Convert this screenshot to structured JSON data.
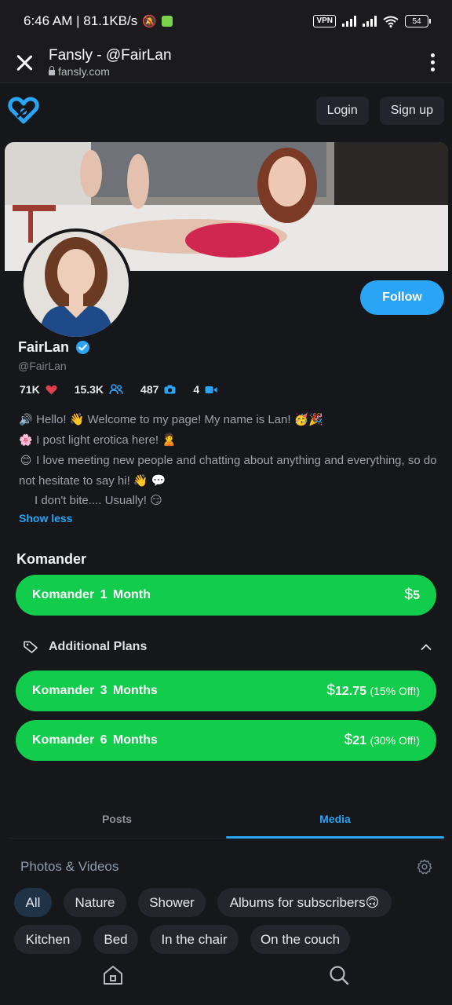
{
  "status_bar": {
    "time_speed": "6:46 AM | 81.1KB/s",
    "vpn": "VPN",
    "battery": "54"
  },
  "browser": {
    "title": "Fansly - @FairLan",
    "url": "fansly.com"
  },
  "header": {
    "login_label": "Login",
    "signup_label": "Sign up"
  },
  "profile": {
    "display_name": "FairLan",
    "handle": "@FairLan",
    "follow_label": "Follow",
    "stats": {
      "likes": "71K",
      "followers": "15.3K",
      "photos": "487",
      "videos": "4"
    },
    "bio": [
      {
        "emoji": "🔊",
        "text": "Hello! 👋 Welcome to my page! My name is Lan! 🥳🎉"
      },
      {
        "emoji": "🌸",
        "text": "I post light erotica here! 🙎"
      },
      {
        "emoji": "😊",
        "text": "I love meeting new people and chatting about anything and everything, so do not hesitate to say hi! 👋 💬"
      },
      {
        "emoji": "",
        "text": "I don't bite.... Usually! 😏"
      }
    ],
    "show_less_label": "Show less"
  },
  "subscriptions": {
    "tier_name": "Komander",
    "main_plan": {
      "name": "Komander 1 Month",
      "currency": "$",
      "price": "5",
      "discount": ""
    },
    "additional_label": "Additional Plans",
    "additional_plans": [
      {
        "name": "Komander 3 Months",
        "currency": "$",
        "price": "12.75",
        "discount": "(15% Off!)"
      },
      {
        "name": "Komander 6 Months",
        "currency": "$",
        "price": "21",
        "discount": "(30% Off!)"
      }
    ]
  },
  "tabs": [
    {
      "label": "Posts",
      "active": false
    },
    {
      "label": "Media",
      "active": true
    }
  ],
  "media": {
    "title": "Photos & Videos",
    "filters": [
      "All",
      "Nature",
      "Shower",
      "Albums for subscribers🙃",
      "Kitchen",
      "Bed",
      "In the chair",
      "On the couch"
    ],
    "active_filter": "All"
  },
  "colors": {
    "accent": "#2aa4f4",
    "plan_green": "#11cd4b",
    "background": "#16171b",
    "like_red": "#e0414f"
  },
  "icons": [
    "close-icon",
    "lock-icon",
    "more-vert-icon",
    "fansly-logo-icon",
    "verified-icon",
    "heart-icon",
    "users-icon",
    "camera-icon",
    "video-icon",
    "tag-icon",
    "chevron-up-icon",
    "gear-icon",
    "home-icon",
    "search-icon"
  ]
}
